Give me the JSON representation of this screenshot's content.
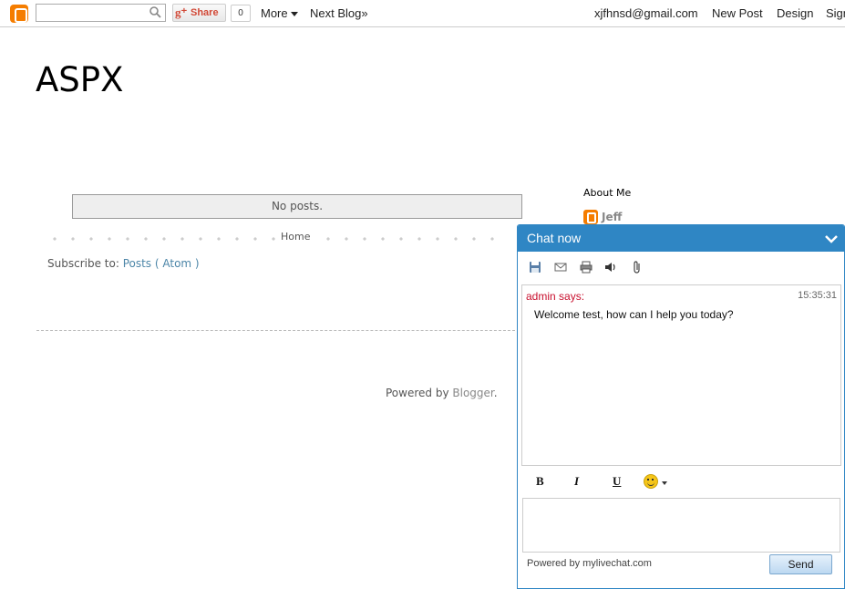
{
  "navbar": {
    "search_placeholder": "",
    "share_label": "Share",
    "share_count": "0",
    "more_label": "More",
    "next_blog_label": "Next Blog»",
    "user_email": "xjfhnsd@gmail.com",
    "new_post_label": "New Post",
    "design_label": "Design",
    "sign_out_label": "Sign out"
  },
  "blog": {
    "title": "ASPX",
    "no_posts": "No posts.",
    "home_label": "Home",
    "subscribe_prefix": "Subscribe to:",
    "subscribe_link": "Posts ( Atom )",
    "powered_prefix": "Powered by",
    "powered_link": "Blogger",
    "powered_suffix": "."
  },
  "sidebar": {
    "about_title": "About Me",
    "profile_name": "Jeff"
  },
  "chat": {
    "title": "Chat now",
    "message": {
      "sender": "admin says:",
      "time": "15:35:31",
      "text": "Welcome test, how can I help you today?"
    },
    "format": {
      "bold": "B",
      "italic": "I",
      "underline": "U"
    },
    "input_value": "",
    "powered_by": "Powered by mylivechat.com",
    "send_label": "Send"
  },
  "colors": {
    "chat_accent": "#2f86c4",
    "blogger_orange": "#f57d00",
    "sender_red": "#c8102e",
    "link_blue": "#4d86a8"
  },
  "icons": [
    "blogger-icon",
    "search-icon",
    "google-plus-icon",
    "save-icon",
    "email-icon",
    "print-icon",
    "sound-icon",
    "attach-icon",
    "chevron-down-icon",
    "emoji-icon"
  ]
}
